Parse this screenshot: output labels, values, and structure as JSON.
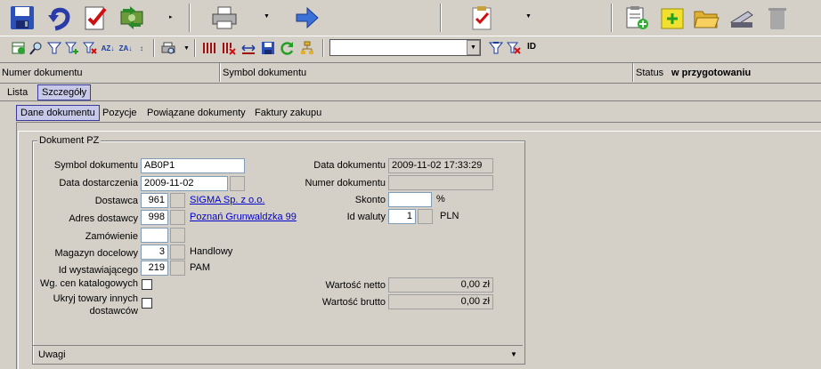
{
  "colors": {
    "background": "#d4d0c8",
    "link": "#0000cc",
    "active_tab": "#c8c8e8"
  },
  "toolbar_main": {
    "icons": [
      "save-icon",
      "undo-icon",
      "validate-icon",
      "refresh-money-icon",
      "print-icon",
      "arrow-right-icon",
      "checklist-icon",
      "add-document-icon",
      "new-note-icon",
      "open-folder-icon",
      "scanner-icon",
      "delete-icon"
    ]
  },
  "toolbar_secondary": {
    "filter_value": "",
    "id_label": "ID"
  },
  "header": {
    "col1": "Numer dokumentu",
    "col2": "Symbol dokumentu",
    "status_label": "Status",
    "status_value": "w przygotowaniu"
  },
  "view_tabs": [
    "Lista",
    "Szczegóły"
  ],
  "sub_tabs": [
    "Dane dokumentu",
    "Pozycje",
    "Powiązane dokumenty",
    "Faktury zakupu"
  ],
  "form": {
    "group_title": "Dokument PZ",
    "symbol_label": "Symbol dokumentu",
    "symbol_value": "AB0P1",
    "delivery_date_label": "Data dostarczenia",
    "delivery_date_value": "2009-11-02",
    "supplier_label": "Dostawca",
    "supplier_id": "961",
    "supplier_name": "SIGMA Sp. z o.o.",
    "address_label": "Adres dostawcy",
    "address_id": "998",
    "address_text": "Poznań Grunwaldzka 99",
    "order_label": "Zamówienie",
    "order_value": "",
    "warehouse_label": "Magazyn docelowy",
    "warehouse_id": "3",
    "warehouse_name": "Handlowy",
    "issuer_label": "Id wystawiającego",
    "issuer_id": "219",
    "issuer_name": "PAM",
    "catalog_prices_label": "Wg. cen katalogowych",
    "catalog_prices_checked": false,
    "hide_other_label_1": "Ukryj towary innych",
    "hide_other_label_2": "dostawców",
    "hide_other_checked": false,
    "doc_date_label": "Data dokumentu",
    "doc_date_value": "2009-11-02 17:33:29",
    "doc_number_label": "Numer dokumentu",
    "doc_number_value": "",
    "discount_label": "Skonto",
    "discount_value": "",
    "discount_unit": "%",
    "currency_label": "Id waluty",
    "currency_id": "1",
    "currency_code": "PLN",
    "net_label": "Wartość netto",
    "net_value": "0,00 zł",
    "gross_label": "Wartość brutto",
    "gross_value": "0,00 zł",
    "notes_label": "Uwagi"
  }
}
